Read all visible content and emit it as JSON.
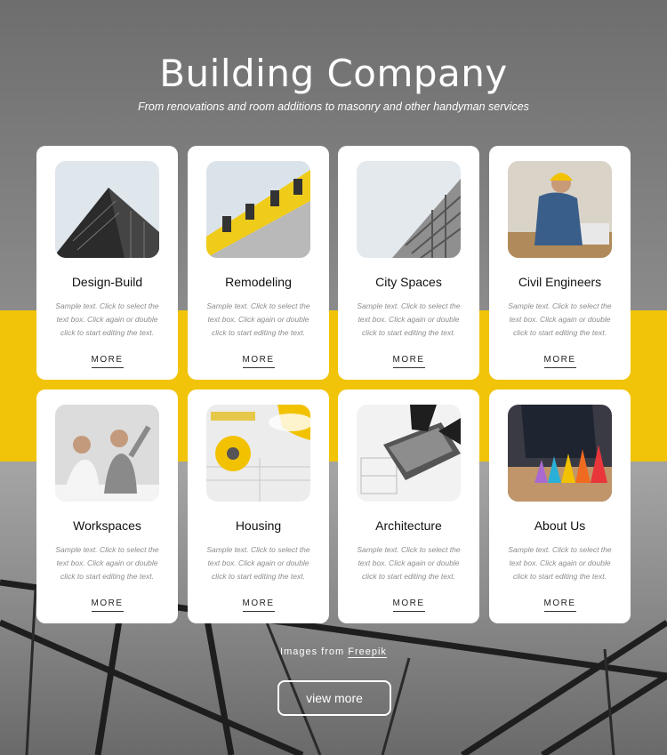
{
  "header": {
    "title": "Building Company",
    "subtitle": "From renovations and room additions to masonry and other handyman services"
  },
  "colors": {
    "accent": "#f1c40a",
    "card_bg": "#ffffff",
    "text_dark": "#111111",
    "text_muted": "#8c8c8c"
  },
  "services": [
    {
      "title": "Design-Build",
      "text": "Sample text. Click to select the text box. Click again or double click to start editing the text.",
      "more": "MORE",
      "image": "building-facade-image"
    },
    {
      "title": "Remodeling",
      "text": "Sample text. Click to select the text box. Click again or double click to start editing the text.",
      "more": "MORE",
      "image": "yellow-building-image"
    },
    {
      "title": "City Spaces",
      "text": "Sample text. Click to select the text box. Click again or double click to start editing the text.",
      "more": "MORE",
      "image": "tower-balconies-image"
    },
    {
      "title": "Civil Engineers",
      "text": "Sample text. Click to select the text box. Click again or double click to start editing the text.",
      "more": "MORE",
      "image": "engineer-hardhat-image"
    },
    {
      "title": "Workspaces",
      "text": "Sample text. Click to select the text box. Click again or double click to start editing the text.",
      "more": "MORE",
      "image": "colleagues-office-image"
    },
    {
      "title": "Housing",
      "text": "Sample text. Click to select the text box. Click again or double click to start editing the text.",
      "more": "MORE",
      "image": "blueprints-tape-image"
    },
    {
      "title": "Architecture",
      "text": "Sample text. Click to select the text box. Click again or double click to start editing the text.",
      "more": "MORE",
      "image": "laptop-plans-image"
    },
    {
      "title": "About Us",
      "text": "Sample text. Click to select the text box. Click again or double click to start editing the text.",
      "more": "MORE",
      "image": "color-pyramids-image"
    }
  ],
  "footer": {
    "credit_prefix": "Images from",
    "credit_link": "Freepik",
    "view_more": "view more"
  }
}
